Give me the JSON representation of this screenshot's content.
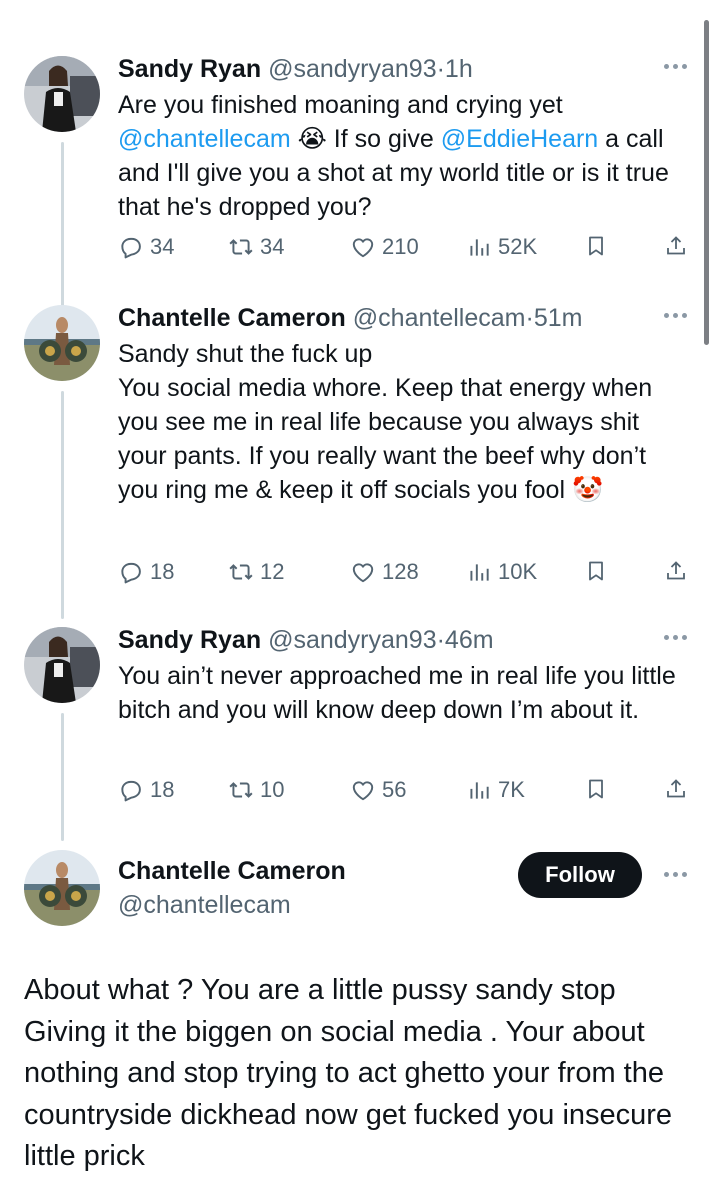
{
  "tweets": [
    {
      "name": "Sandy Ryan",
      "handle": "@sandyryan93",
      "separator": "·",
      "time": "1h",
      "text_parts": [
        "Are you finished moaning and crying yet\n",
        "@chantellecam",
        " 😭 If so give ",
        "@EddieHearn",
        " a call and I'll give you a shot at my world title or is it true that he's dropped you?"
      ],
      "stats": {
        "replies": "34",
        "reposts": "34",
        "likes": "210",
        "views": "52K"
      }
    },
    {
      "name": "Chantelle Cameron",
      "handle": "@chantellecam",
      "separator": "·",
      "time": "51m",
      "text": "Sandy shut the fuck up\nYou social media whore. Keep that energy when you see me in real life because you always shit your pants. If you really want the beef why don’t you ring me & keep it off socials you fool 🤡",
      "stats": {
        "replies": "18",
        "reposts": "12",
        "likes": "128",
        "views": "10K"
      }
    },
    {
      "name": "Sandy Ryan",
      "handle": "@sandyryan93",
      "separator": "·",
      "time": "46m",
      "text": "You ain’t never approached me in real life you little bitch and you will know deep down I’m about it.",
      "stats": {
        "replies": "18",
        "reposts": "10",
        "likes": "56",
        "views": "7K"
      }
    }
  ],
  "main_tweet": {
    "name": "Chantelle Cameron",
    "handle": "@chantellecam",
    "follow_label": "Follow",
    "text": "About what ? You are a little pussy sandy stop Giving it the biggen on social media . Your about nothing and stop trying to act ghetto your from the countryside dickhead now get fucked you insecure little prick"
  },
  "icons": {
    "reply": "reply-icon",
    "repost": "repost-icon",
    "like": "heart-icon",
    "views": "views-icon",
    "bookmark": "bookmark-icon",
    "share": "share-icon",
    "more": "more-dots-icon"
  },
  "colors": {
    "text": "#0f1419",
    "secondary": "#536471",
    "link": "#1d9bf0",
    "thread_line": "#cfd9de",
    "follow_bg": "#0f1419"
  }
}
